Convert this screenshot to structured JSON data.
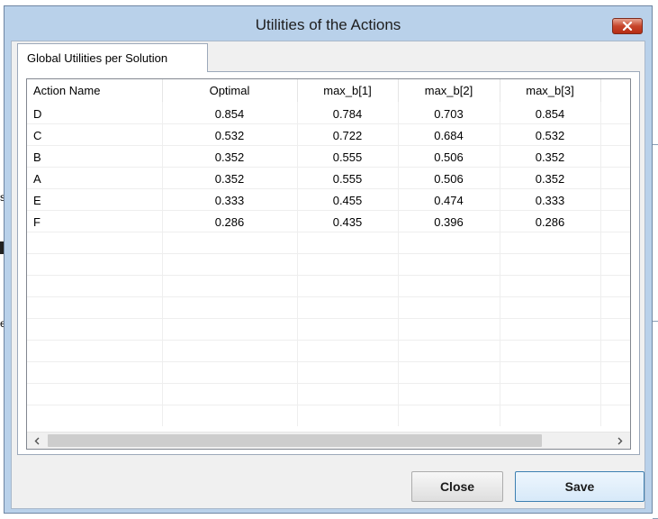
{
  "window": {
    "title": "Utilities of the Actions"
  },
  "tabs": [
    {
      "label": "Global Utilities per Solution"
    }
  ],
  "table": {
    "columns": [
      "Action Name",
      "Optimal",
      "max_b[1]",
      "max_b[2]",
      "max_b[3]"
    ],
    "rows": [
      [
        "D",
        "0.854",
        "0.784",
        "0.703",
        "0.854"
      ],
      [
        "C",
        "0.532",
        "0.722",
        "0.684",
        "0.532"
      ],
      [
        "B",
        "0.352",
        "0.555",
        "0.506",
        "0.352"
      ],
      [
        "A",
        "0.352",
        "0.555",
        "0.506",
        "0.352"
      ],
      [
        "E",
        "0.333",
        "0.455",
        "0.474",
        "0.333"
      ],
      [
        "F",
        "0.286",
        "0.435",
        "0.396",
        "0.286"
      ]
    ]
  },
  "buttons": {
    "close": "Close",
    "save": "Save"
  },
  "background": {
    "fragments": [
      "s",
      "e"
    ]
  },
  "icons": {
    "close": "close-x-icon",
    "scroll_left": "chevron-left-icon",
    "scroll_right": "chevron-right-icon"
  }
}
